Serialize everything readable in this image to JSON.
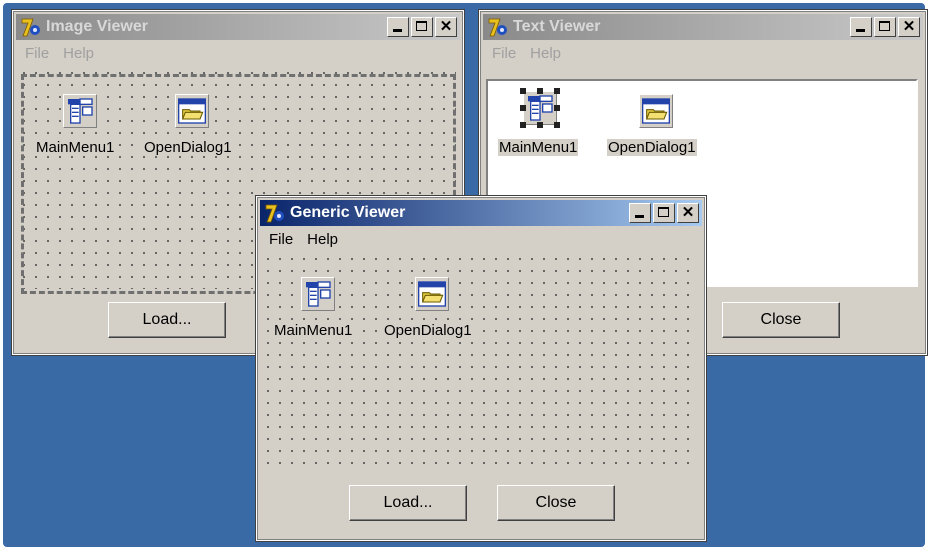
{
  "colors": {
    "desktop": "#3a6aa6",
    "window_face": "#d4d0c8",
    "active_title_start": "#0a246a",
    "active_title_end": "#a6caf0",
    "inactive_title": "#8a8a8a"
  },
  "windows": {
    "image_viewer": {
      "title": "Image Viewer",
      "menu": [
        "File",
        "Help"
      ],
      "components": [
        "MainMenu1",
        "OpenDialog1"
      ],
      "buttons": [
        "Load..."
      ]
    },
    "text_viewer": {
      "title": "Text Viewer",
      "menu": [
        "File",
        "Help"
      ],
      "components": [
        "MainMenu1",
        "OpenDialog1"
      ],
      "buttons": [
        "Close"
      ]
    },
    "generic_viewer": {
      "title": "Generic Viewer",
      "menu": [
        "File",
        "Help"
      ],
      "components": [
        "MainMenu1",
        "OpenDialog1"
      ],
      "buttons": [
        "Load...",
        "Close"
      ]
    }
  },
  "icons": {
    "app": "delphi-app-icon",
    "main_menu": "main-menu-component-icon",
    "open_dialog": "open-dialog-component-icon",
    "minimize": "minimize-icon",
    "maximize": "maximize-icon",
    "close": "close-icon"
  }
}
